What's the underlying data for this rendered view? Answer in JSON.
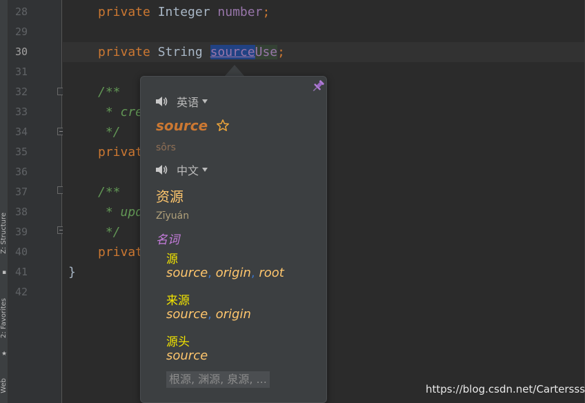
{
  "tool_window": {
    "tabs": [
      {
        "label": "Z: Structure",
        "icon": "structure-icon"
      },
      {
        "label": "2: Favorites",
        "icon": "star-icon"
      },
      {
        "label": "Web",
        "icon": "web-icon"
      }
    ]
  },
  "gutter": {
    "line_numbers": [
      "28",
      "29",
      "30",
      "31",
      "32",
      "33",
      "34",
      "35",
      "36",
      "37",
      "38",
      "39",
      "40",
      "41",
      "42"
    ]
  },
  "code": {
    "line28": {
      "kw": "private",
      "type": "Integer",
      "field": "number",
      "end": ";"
    },
    "line30": {
      "kw": "private",
      "type": "String",
      "ident_hl": "source",
      "ident_rest": "Use",
      "end": ";"
    },
    "line32": "/**",
    "line33": " * cre",
    "line34": " */",
    "line35": "privat",
    "line37": "/**",
    "line38": " * upd",
    "line39": " */",
    "line40": "privat",
    "line41": "}"
  },
  "popup": {
    "source_lang": "英语",
    "word": "source",
    "phonetic": "sôrs",
    "target_lang": "中文",
    "translation": "资源",
    "translation_phonetic": "Zīyuán",
    "part_of_speech": "名词",
    "entries": [
      {
        "head": "源",
        "words": [
          "source",
          "origin",
          "root"
        ]
      },
      {
        "head": "来源",
        "words": [
          "source",
          "origin"
        ]
      },
      {
        "head": "源头",
        "words": [
          "source"
        ]
      }
    ],
    "more": "根源, 渊源, 泉源, ..."
  },
  "watermark": "https://blog.csdn.net/Carterssss",
  "colors": {
    "keyword": "#cc7832",
    "field": "#9876aa",
    "comment": "#629755",
    "translation": "#ffc66d",
    "pos": "#c77dde",
    "entry_head": "#f2e400"
  }
}
